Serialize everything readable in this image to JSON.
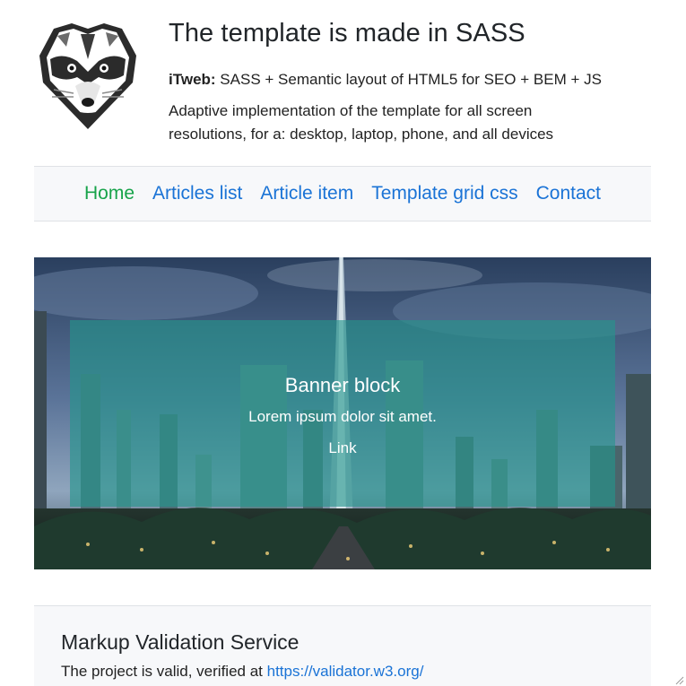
{
  "header": {
    "title": "The template is made in SASS",
    "tagline_brand": "iTweb:",
    "tagline_text": " SASS + Semantic layout of HTML5 for SEO + BEM + JS",
    "description": "Adaptive implementation of the template for all screen resolutions, for a: desktop, laptop, phone, and all devices",
    "logo_icon": "raccoon-logo-icon"
  },
  "nav": {
    "items": [
      {
        "label": "Home",
        "active": true
      },
      {
        "label": "Articles list",
        "active": false
      },
      {
        "label": "Article item",
        "active": false
      },
      {
        "label": "Template grid css",
        "active": false
      },
      {
        "label": "Contact",
        "active": false
      }
    ]
  },
  "banner": {
    "title": "Banner block",
    "text": "Lorem ipsum dolor sit amet.",
    "link": "Link"
  },
  "validation": {
    "title": "Markup Validation Service",
    "text": "The project is valid, verified at ",
    "link": "https://validator.w3.org/"
  },
  "colors": {
    "link": "#1a73d6",
    "active_link": "#17a34a",
    "overlay": "#24968c",
    "panel_bg": "#f7f8fa"
  }
}
